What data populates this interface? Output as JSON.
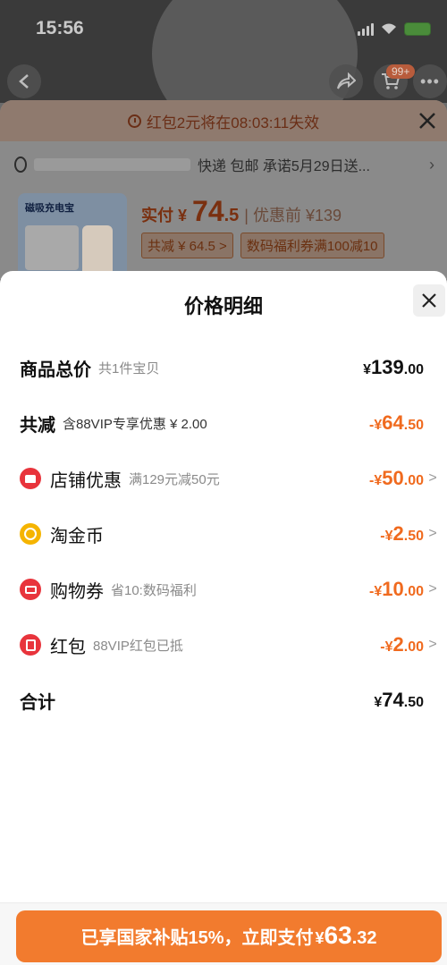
{
  "status_bar": {
    "time": "15:56"
  },
  "background": {
    "cart_badge": "99+",
    "countdown": "红包2元将在08:03:11失效",
    "address_suffix": "快递 包邮 承诺5月29日送...",
    "product_title": "磁吸充电宝",
    "price_label": "实付 ¥",
    "price_int": "74",
    "price_dec": ".5",
    "price_before": "| 优惠前 ¥139",
    "chip_discount": "共减 ¥ 64.5 >",
    "chip_coupon": "数码福利券满100减10"
  },
  "sheet": {
    "title": "价格明细",
    "rows": [
      {
        "label": "商品总价",
        "sub": "共1件宝贝",
        "cur": "¥",
        "int": "139",
        "dec": ".00",
        "color": "black"
      },
      {
        "label": "共减",
        "sub": "含88VIP专享优惠 ¥ 2.00",
        "cur": "-¥",
        "int": "64",
        "dec": ".50",
        "color": "orange"
      },
      {
        "label": "店铺优惠",
        "sub": "满129元减50元",
        "cur": "-¥",
        "int": "50",
        "dec": ".00",
        "color": "orange",
        "icon": "shop-icon"
      },
      {
        "label": "淘金币",
        "sub": "",
        "cur": "-¥",
        "int": "2",
        "dec": ".50",
        "color": "orange",
        "icon": "coin-icon"
      },
      {
        "label": "购物券",
        "sub": "省10:数码福利",
        "cur": "-¥",
        "int": "10",
        "dec": ".00",
        "color": "orange",
        "icon": "ticket-icon"
      },
      {
        "label": "红包",
        "sub": "88VIP红包已抵",
        "cur": "-¥",
        "int": "2",
        "dec": ".00",
        "color": "orange",
        "icon": "red-packet-icon"
      },
      {
        "label": "合计",
        "sub": "",
        "cur": "¥",
        "int": "74",
        "dec": ".50",
        "color": "black"
      }
    ],
    "chevron": ">"
  },
  "pay_button": {
    "text": "已享国家补贴15%，立即支付",
    "cur": "¥",
    "int": "63",
    "dec": ".32"
  },
  "colors": {
    "accent": "#f27b2e",
    "discount": "#f06a1e",
    "icon_red": "#e8343c",
    "icon_gold": "#f5b400"
  }
}
